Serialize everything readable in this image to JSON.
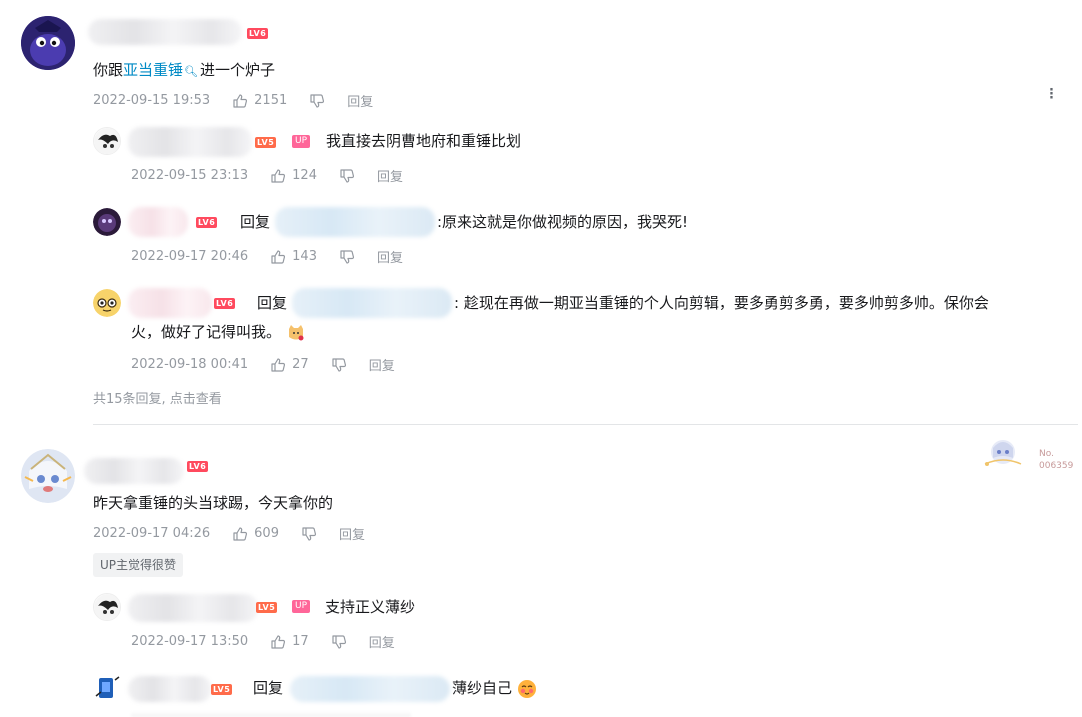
{
  "comments": [
    {
      "level": "LV6",
      "text_before": "你跟",
      "link_text": "亚当重锤",
      "text_after": "进一个炉子",
      "time": "2022-09-15 19:53",
      "likes": "2151",
      "reply_label": "回复",
      "more_icon": "⋮",
      "replies": [
        {
          "level": "LV5",
          "up_tag": "UP",
          "text": "我直接去阴曹地府和重锤比划",
          "time": "2022-09-15 23:13",
          "likes": "124",
          "reply_label": "回复"
        },
        {
          "level": "LV6",
          "reply_prefix": "回复",
          "text": ":原来这就是你做视频的原因，我哭死!",
          "time": "2022-09-17 20:46",
          "likes": "143",
          "reply_label": "回复"
        },
        {
          "level": "LV6",
          "reply_prefix": "回复",
          "text_line1": ": 趁现在再做一期亚当重锤的个人向剪辑，要多勇剪多勇，要多帅剪多帅。保你会",
          "text_line2": "火，做好了记得叫我。",
          "time": "2022-09-18 00:41",
          "likes": "27",
          "reply_label": "回复"
        }
      ],
      "view_more": "共15条回复, 点击查看"
    },
    {
      "level": "LV6",
      "text": "昨天拿重锤的头当球踢，今天拿你的",
      "time": "2022-09-17 04:26",
      "likes": "609",
      "reply_label": "回复",
      "badge": "UP主觉得很赞",
      "fan_no_label": "No.",
      "fan_no": "006359",
      "replies": [
        {
          "level": "LV5",
          "up_tag": "UP",
          "text": "支持正义薄纱",
          "time": "2022-09-17 13:50",
          "likes": "17",
          "reply_label": "回复"
        },
        {
          "level": "LV5",
          "reply_prefix": "回复",
          "text": "薄纱自己",
          "time": "",
          "likes": "",
          "reply_label": ""
        }
      ]
    }
  ],
  "colors": {
    "link": "#008ac5",
    "meta": "#9499a0",
    "level6": "#ff4a5e",
    "level5": "#ff6b4a",
    "up": "#ff6699"
  },
  "icons": {
    "like": "thumb-up-icon",
    "dislike": "thumb-down-icon",
    "search": "search-icon",
    "more": "more-vertical-icon"
  }
}
